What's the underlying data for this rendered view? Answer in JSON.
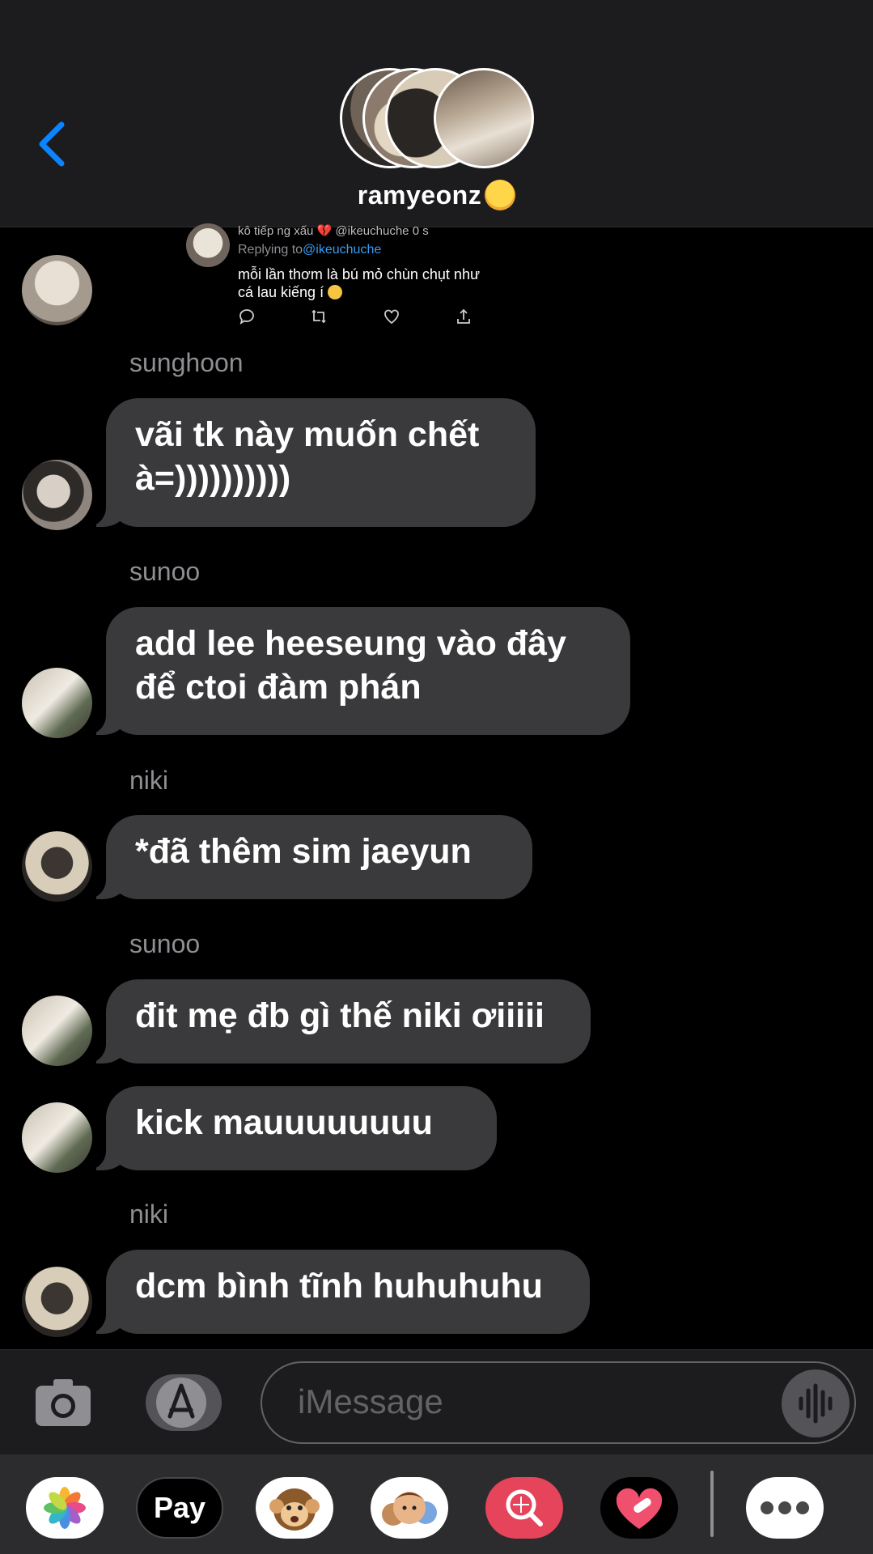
{
  "header": {
    "group_name": "ramyeonz"
  },
  "tweet": {
    "display": "kô tiếp ng xấu 💔  @ikeuchuche   0 s",
    "replying_prefix": "Replying to",
    "replying_handle": "@ikeuchuche",
    "text": "mỗi lần thơm là bú mỏ chùn chụt như cá lau kiếng í"
  },
  "messages": [
    {
      "sender": "sunghoon",
      "text": "vãi tk này muốn chết à=))))))))))"
    },
    {
      "sender": "sunoo",
      "text": "add lee heeseung vào đây để ctoi đàm phán"
    },
    {
      "sender": "niki",
      "text": "*đã thêm sim jaeyun"
    },
    {
      "sender": "sunoo",
      "text": "đit mẹ đb gì thế niki ơiiiii"
    },
    {
      "sender": "",
      "text": "kick mauuuuuuuu"
    },
    {
      "sender": "niki",
      "text": "dcm bình tĩnh huhuhuhu"
    }
  ],
  "input": {
    "placeholder": "iMessage"
  },
  "drawer": {
    "apps": [
      "photos",
      "apple-pay",
      "animoji",
      "memoji",
      "image-search",
      "digital-touch",
      "more"
    ],
    "apple_pay_label": "Pay"
  },
  "colors": {
    "accent": "#0a84ff",
    "bubble": "#3a3a3c",
    "header": "#1c1c1e",
    "sender": "#8e8e93"
  }
}
